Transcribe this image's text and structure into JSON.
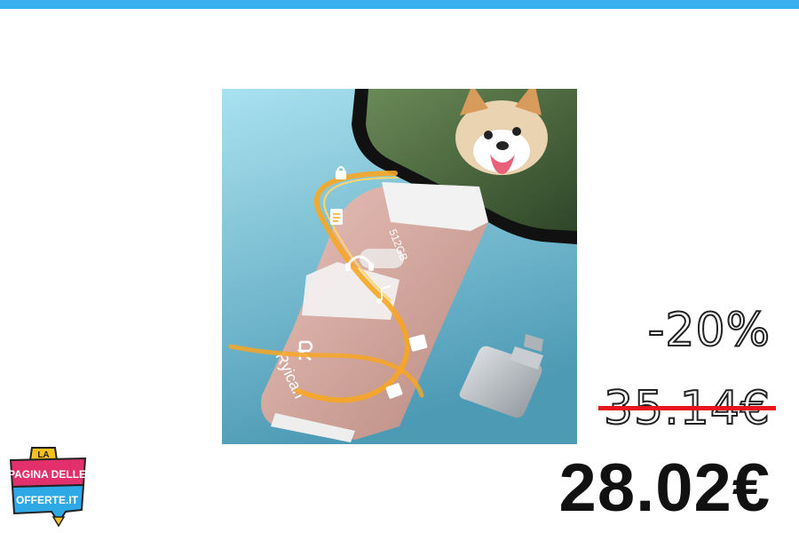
{
  "colors": {
    "top_bar": "#3bb0f0",
    "strike": "#e8141b",
    "usb_body": "#d9a79e",
    "logo_pink": "#e2306c",
    "logo_blue": "#2fa8e6",
    "logo_yellow": "#f7c21d"
  },
  "product": {
    "capacity_label": "512GB",
    "brand_label": "Ryican",
    "brand_icon": "r-logo-icon"
  },
  "pricing": {
    "discount": "-20%",
    "old_price": "35.14€",
    "new_price": "28.02€"
  },
  "logo": {
    "line1": "LA",
    "line2": "PAGINA DELLE",
    "line3": "OFFERTE.IT"
  }
}
